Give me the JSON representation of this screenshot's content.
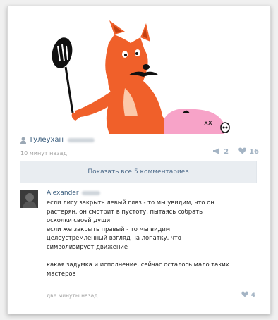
{
  "post": {
    "author": "Тулеухан",
    "time": "10 минут назад",
    "reposts": "2",
    "likes": "16"
  },
  "show_comments_label": "Показать все 5 комментариев",
  "comment": {
    "author": "Alexander",
    "lines": [
      "если лису закрыть левый глаз - то мы увидим, что он",
      "растерян. он смотрит в пустоту, пытаясь собрать",
      "осколки своей души",
      "если же закрыть правый - то мы видим",
      "целеустремленный взгляд на лопатку, что",
      "символизирует движение",
      "",
      "какая задумка и исполнение, сейчас осталось мало таких",
      "мастеров"
    ],
    "time": "две минуты назад",
    "likes": "4"
  },
  "colors": {
    "fox": "#f0602a",
    "pig": "#f7a3c8",
    "link": "#3b5e7e",
    "accent_button": "#e9edf1"
  },
  "icons": [
    "user-icon",
    "megaphone-icon",
    "heart-icon"
  ]
}
